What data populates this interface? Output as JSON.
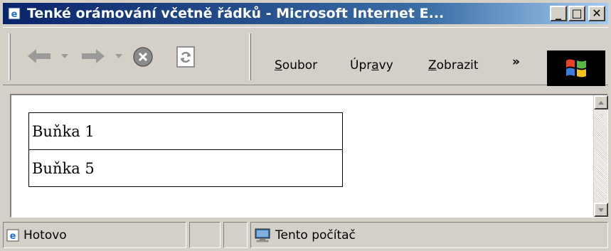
{
  "window": {
    "title": "Tenké orámování včetně řádků - Microsoft Internet E..."
  },
  "title_buttons": {
    "minimize": "_",
    "maximize": "□",
    "close": "✕"
  },
  "menu": {
    "items": [
      {
        "label": "Soubor",
        "access_key": "S"
      },
      {
        "label": "Úpravy",
        "access_key": "a"
      },
      {
        "label": "Zobrazit",
        "access_key": "Z"
      }
    ],
    "more": "»"
  },
  "table": {
    "rows": [
      "Buňka 1",
      "Buňka 5"
    ]
  },
  "status": {
    "text": "Hotovo",
    "zone": "Tento počítač"
  },
  "icons": {
    "title": "ie-page-icon",
    "back": "back-arrow-icon",
    "forward": "forward-arrow-icon",
    "stop": "stop-icon",
    "refresh": "refresh-icon",
    "logo": "windows-logo-icon",
    "status": "ie-page-icon",
    "zone": "computer-icon"
  },
  "colors": {
    "titlebar_start": "#0a246a",
    "titlebar_end": "#a6caf0",
    "chrome": "#d4d0c8"
  }
}
